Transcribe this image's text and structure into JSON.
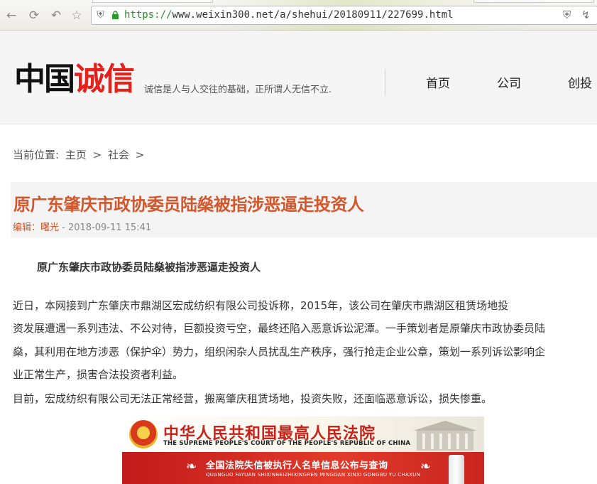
{
  "browser": {
    "url_scheme": "https://",
    "url_rest": "www.weixin300.net/a/shehui/20180911/227699.html",
    "icons": [
      "back-icon",
      "reload-icon",
      "undo-icon",
      "star-icon",
      "shield-icon",
      "lock-icon",
      "tracking-shield-icon",
      "lightning-icon"
    ]
  },
  "site": {
    "logo_black": "中国",
    "logo_red": "诚信",
    "slogan": "诚信是人与人交往的基础，正所谓人无信不立.",
    "nav": [
      "首页",
      "公司",
      "创投"
    ],
    "colors": {
      "brand_red": "#e4211b",
      "title_orange": "#d2572c"
    }
  },
  "breadcrumb": {
    "prefix": "当前位置:",
    "items": [
      "主页",
      "社会"
    ],
    "separator": ">"
  },
  "article": {
    "title": "原广东肇庆市政协委员陆燊被指涉恶逼走投资人",
    "editor": "编辑：曙光",
    "date": "- 2018-09-11 15:41",
    "subhead": "原广东肇庆市政协委员陆燊被指涉恶逼走投资人",
    "para1": [
      "        近日，本网接到广东肇庆市鼎湖区宏成纺织有限公司投诉称，2015年，该公司在肇庆市鼎湖区租赁场地投",
      "资发展遭遇一系列违法、不公对待，巨额投资亏空，最终还陷入恶意诉讼泥潭。一手策划者是原肇庆市政协委员陆",
      "燊，其利用在地方涉恶（保护伞）势力，组织闲杂人员扰乱生产秩序，强行抢走企业公章，策划一系列诉讼影响企",
      "业正常生产，损害合法投资者利益。"
    ],
    "para2": "   目前，宏成纺织有限公司无法正常经营，搬离肇庆租赁场地，投资失败，还面临恶意诉讼，损失惨重。"
  },
  "banner": {
    "court_cn": "中华人民共和国最高人民法院",
    "court_en": "THE SUPREME PEOPLE'S COURT OF THE PEOPLE'S REPUBLIC OF CHINA",
    "query_cn": "全国法院失信被执行人名单信息公布与查询",
    "query_py": "QUANGUO FAYUAN SHIXINBEIZHIXINGREN MINGDAN XINXI GONGBU YU CHAXUN"
  }
}
